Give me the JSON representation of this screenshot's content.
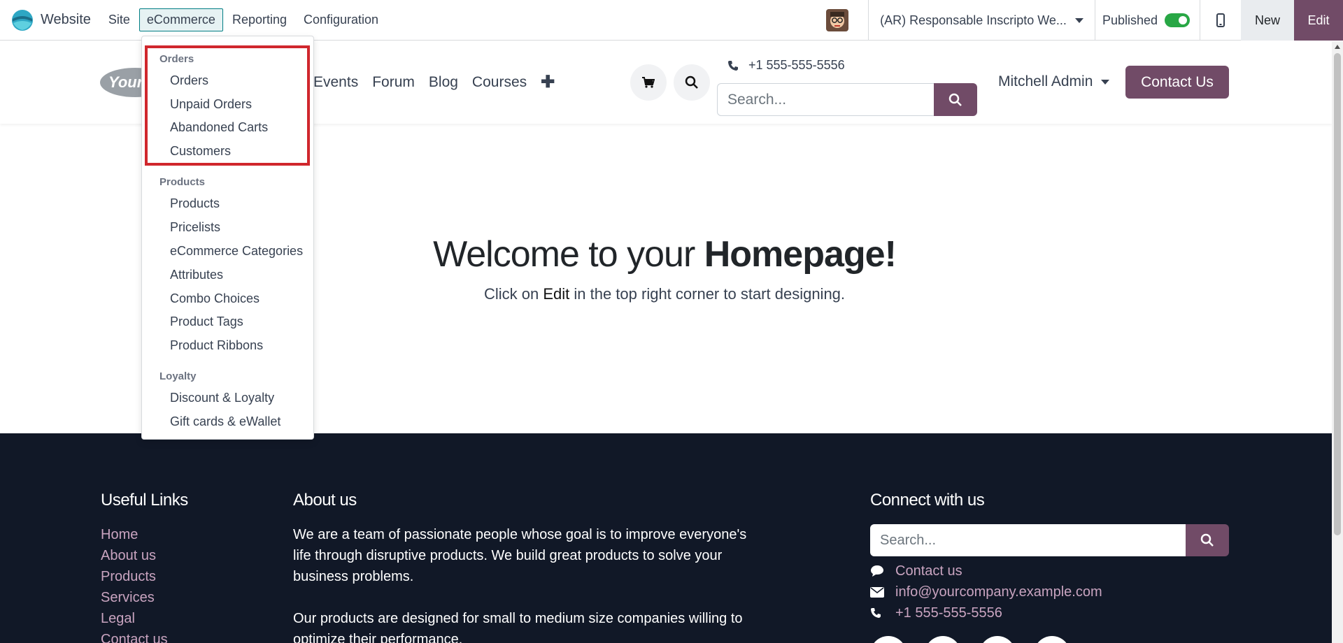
{
  "topbar": {
    "app_name": "Website",
    "menu": [
      "Site",
      "eCommerce",
      "Reporting",
      "Configuration"
    ],
    "website_name": "(AR) Responsable Inscripto We...",
    "published_label": "Published",
    "published": true,
    "new_label": "New",
    "edit_label": "Edit"
  },
  "header": {
    "logo_text": "Your",
    "nav": [
      "Events",
      "Forum",
      "Blog",
      "Courses"
    ],
    "phone": "+1 555-555-5556",
    "search_placeholder": "Search...",
    "user": "Mitchell Admin",
    "contact_button": "Contact Us"
  },
  "dropdown": {
    "sections": [
      {
        "title": "Orders",
        "items": [
          "Orders",
          "Unpaid Orders",
          "Abandoned Carts",
          "Customers"
        ]
      },
      {
        "title": "Products",
        "items": [
          "Products",
          "Pricelists",
          "eCommerce Categories",
          "Attributes",
          "Combo Choices",
          "Product Tags",
          "Product Ribbons"
        ]
      },
      {
        "title": "Loyalty",
        "items": [
          "Discount & Loyalty",
          "Gift cards & eWallet"
        ]
      }
    ]
  },
  "main": {
    "title_prefix": "Welcome to your ",
    "title_bold": "Homepage!",
    "subtitle_before": "Click on ",
    "subtitle_bold": "Edit",
    "subtitle_after": " in the top right corner to start designing."
  },
  "footer": {
    "useful_links_title": "Useful Links",
    "links": [
      "Home",
      "About us",
      "Products",
      "Services",
      "Legal",
      "Contact us"
    ],
    "about_title": "About us",
    "about_p1": "We are a team of passionate people whose goal is to improve everyone's life through disruptive products. We build great products to solve your business problems.",
    "about_p2": "Our products are designed for small to medium size companies willing to optimize their performance.",
    "connect_title": "Connect with us",
    "search_placeholder": "Search...",
    "contact_us": "Contact us",
    "email": "info@yourcompany.example.com",
    "phone": "+1 555-555-5556"
  },
  "colors": {
    "brand": "#714b67",
    "footer_bg": "#111827",
    "footer_link": "#c9a4c0",
    "highlight": "#d0272d",
    "toggle_on": "#28a745"
  }
}
